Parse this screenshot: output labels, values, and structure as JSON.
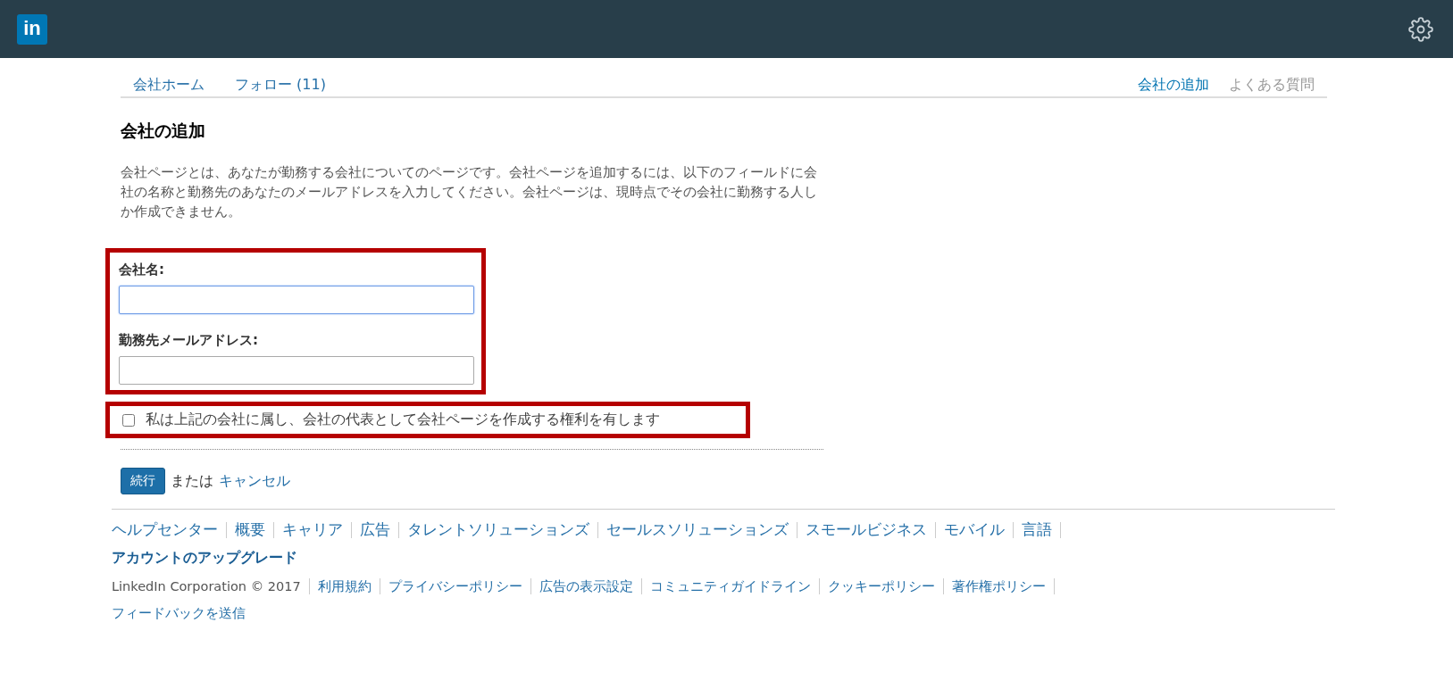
{
  "header": {
    "logo": "in"
  },
  "nav": {
    "left": [
      {
        "label": "会社ホーム",
        "selected": false
      },
      {
        "label": "フォロー (11)",
        "selected": false
      }
    ],
    "right": [
      {
        "label": "会社の追加",
        "selected": true
      },
      {
        "label": "よくある質問",
        "selected": false
      }
    ]
  },
  "page": {
    "title": "会社の追加",
    "description": "会社ページとは、あなたが勤務する会社についてのページです。会社ページを追加するには、以下のフィールドに会社の名称と勤務先のあなたのメールアドレスを入力してください。会社ページは、現時点でその会社に勤務する人しか作成できません。"
  },
  "form": {
    "fields": [
      {
        "label": "会社名:",
        "focused": true
      },
      {
        "label": "勤務先メールアドレス:",
        "focused": false
      }
    ],
    "agreement": {
      "label": "私は上記の会社に属し、会社の代表として会社ページを作成する権利を有します",
      "checked": false
    },
    "submit": "続行",
    "or": "または",
    "cancel": "キャンセル"
  },
  "footer": {
    "links": [
      "ヘルプセンター",
      "概要",
      "キャリア",
      "広告",
      "タレントソリューションズ",
      "セールスソリューションズ",
      "スモールビジネス",
      "モバイル",
      "言語"
    ],
    "upgrade": "アカウントのアップグレード",
    "legal": [
      "LinkedIn Corporation © 2017",
      "利用規約",
      "プライバシーポリシー",
      "広告の表示設定",
      "コミュニティガイドライン",
      "クッキーポリシー",
      "著作権ポリシー"
    ],
    "feedback": "フィードバックを送信"
  }
}
